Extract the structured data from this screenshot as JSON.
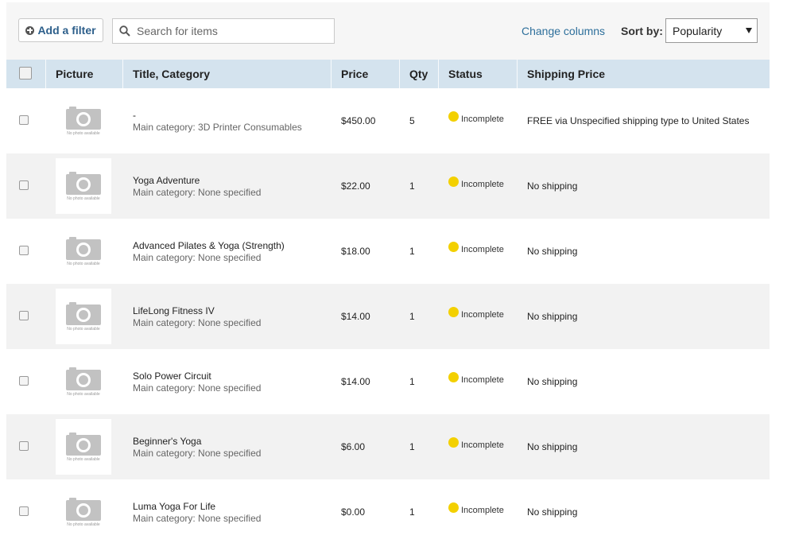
{
  "toolbar": {
    "add_filter_label": "Add a filter",
    "search_placeholder": "Search for items",
    "change_columns_label": "Change columns",
    "sort_label": "Sort by:",
    "sort_value": "Popularity"
  },
  "columns": {
    "picture": "Picture",
    "title": "Title, Category",
    "price": "Price",
    "qty": "Qty",
    "status": "Status",
    "shipping": "Shipping Price"
  },
  "no_photo_text": "No photo available",
  "colors": {
    "header_bg": "#d4e3ee",
    "link": "#2d6f9b",
    "status_incomplete": "#f3d000"
  },
  "rows": [
    {
      "title": "-",
      "category": "Main category: 3D Printer Consumables",
      "price": "$450.00",
      "qty": "5",
      "status": "Incomplete",
      "shipping": "FREE via Unspecified shipping type to United States"
    },
    {
      "title": "Yoga Adventure",
      "category": "Main category: None specified",
      "price": "$22.00",
      "qty": "1",
      "status": "Incomplete",
      "shipping": "No shipping"
    },
    {
      "title": "Advanced Pilates & Yoga (Strength)",
      "category": "Main category: None specified",
      "price": "$18.00",
      "qty": "1",
      "status": "Incomplete",
      "shipping": "No shipping"
    },
    {
      "title": "LifeLong Fitness IV",
      "category": "Main category: None specified",
      "price": "$14.00",
      "qty": "1",
      "status": "Incomplete",
      "shipping": "No shipping"
    },
    {
      "title": "Solo Power Circuit",
      "category": "Main category: None specified",
      "price": "$14.00",
      "qty": "1",
      "status": "Incomplete",
      "shipping": "No shipping"
    },
    {
      "title": "Beginner's Yoga",
      "category": "Main category: None specified",
      "price": "$6.00",
      "qty": "1",
      "status": "Incomplete",
      "shipping": "No shipping"
    },
    {
      "title": "Luma Yoga For Life",
      "category": "Main category: None specified",
      "price": "$0.00",
      "qty": "1",
      "status": "Incomplete",
      "shipping": "No shipping"
    }
  ]
}
